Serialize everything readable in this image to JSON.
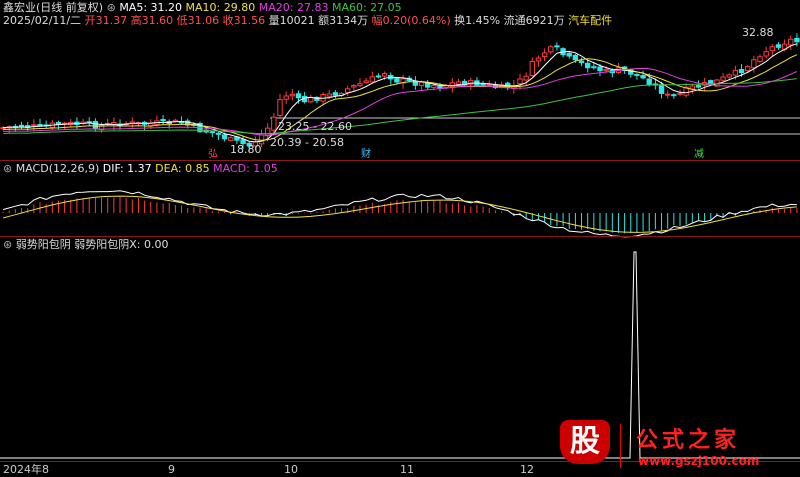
{
  "stock": {
    "name": "鑫宏业(日线 前复权)",
    "ma5": "MA5: 31.20",
    "ma10": "MA10: 29.80",
    "ma20": "MA20: 27.83",
    "ma60": "MA60: 27.05",
    "date": "2025/02/11/二",
    "open": "开31.37",
    "high": "高31.60",
    "low": "低31.06",
    "close": "收31.56",
    "volume": "量10021",
    "amount": "额3134万",
    "change": "幅0.20(0.64%)",
    "turnover": "换1.45%",
    "float": "流通6921万",
    "sector": "汽车配件"
  },
  "price_labels": {
    "high_mark": "32.88",
    "low_mark": "18.80",
    "range1": "23.25 - 22.60",
    "range2": "20.39 - 20.58",
    "tag1": "弘",
    "tag2": "财",
    "tag3": "减"
  },
  "macd": {
    "title": "MACD(12,26,9)",
    "dif": "DIF: 1.37",
    "dea": "DEA: 0.85",
    "macd": "MACD: 1.05"
  },
  "indicator": {
    "title": "弱势阳包阴",
    "value": "弱势阳包阴X: 0.00"
  },
  "axis": {
    "months": [
      "2024年8",
      "9",
      "10",
      "11",
      "12"
    ]
  },
  "watermark": {
    "logo": "股",
    "site_name": "公式之家",
    "url": "www.gszj100.com"
  },
  "colors": {
    "up": "#ff3b3b",
    "down": "#2ee6e6",
    "ma5": "#ffffff",
    "ma10": "#f0e040",
    "ma20": "#e040e0",
    "ma60": "#40c040",
    "separator": "#8a1a1a"
  }
}
